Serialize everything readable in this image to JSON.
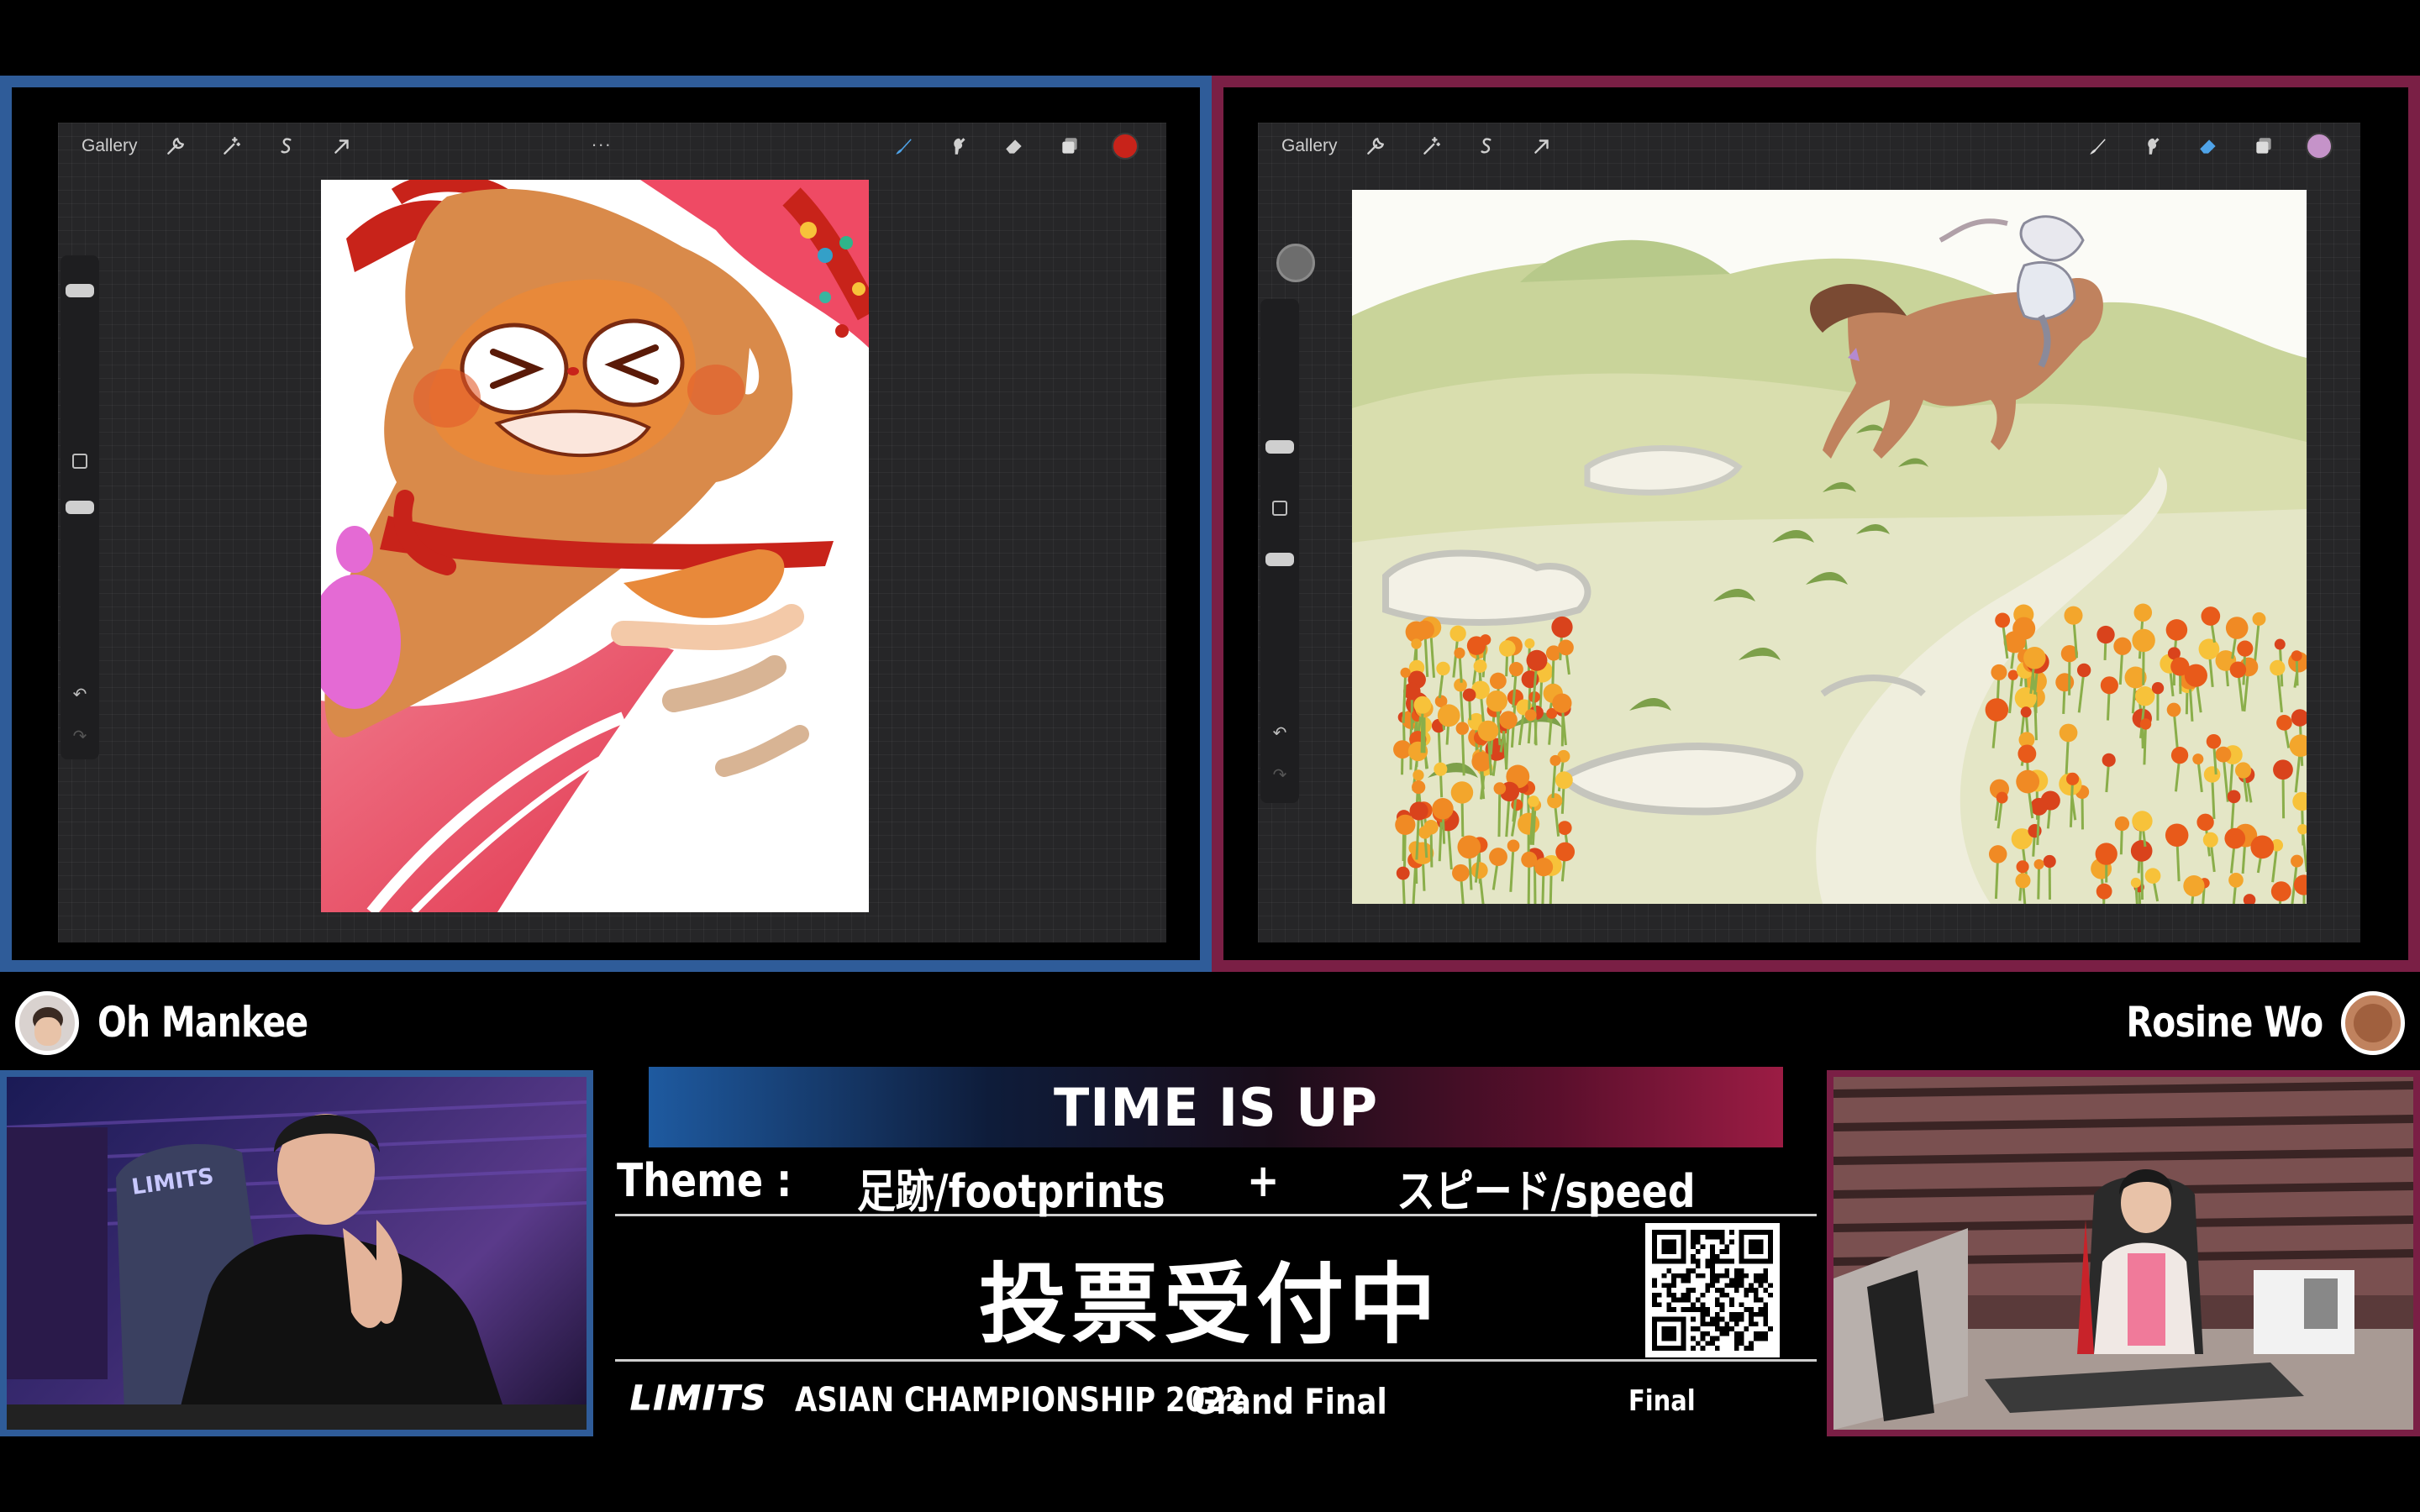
{
  "left_screen": {
    "gallery_label": "Gallery",
    "menu_dots": "...",
    "active_color": "#c8231a",
    "accent": "#2f5c99"
  },
  "right_screen": {
    "gallery_label": "Gallery",
    "active_color": "#c593c9",
    "accent": "#7a1f45"
  },
  "players": {
    "left_name": "Oh Mankee",
    "right_name": "Rosine Wo"
  },
  "overlay": {
    "status_banner": "TIME IS UP",
    "theme_label": "Theme :",
    "theme_1": "足跡/footprints",
    "theme_plus": "+",
    "theme_2": "スピード/speed",
    "voting_text": "投票受付中"
  },
  "footer": {
    "logo": "LIMITS",
    "championship": "ASIAN CHAMPIONSHIP 2022",
    "round": "Grand Final",
    "stage": "Final"
  }
}
